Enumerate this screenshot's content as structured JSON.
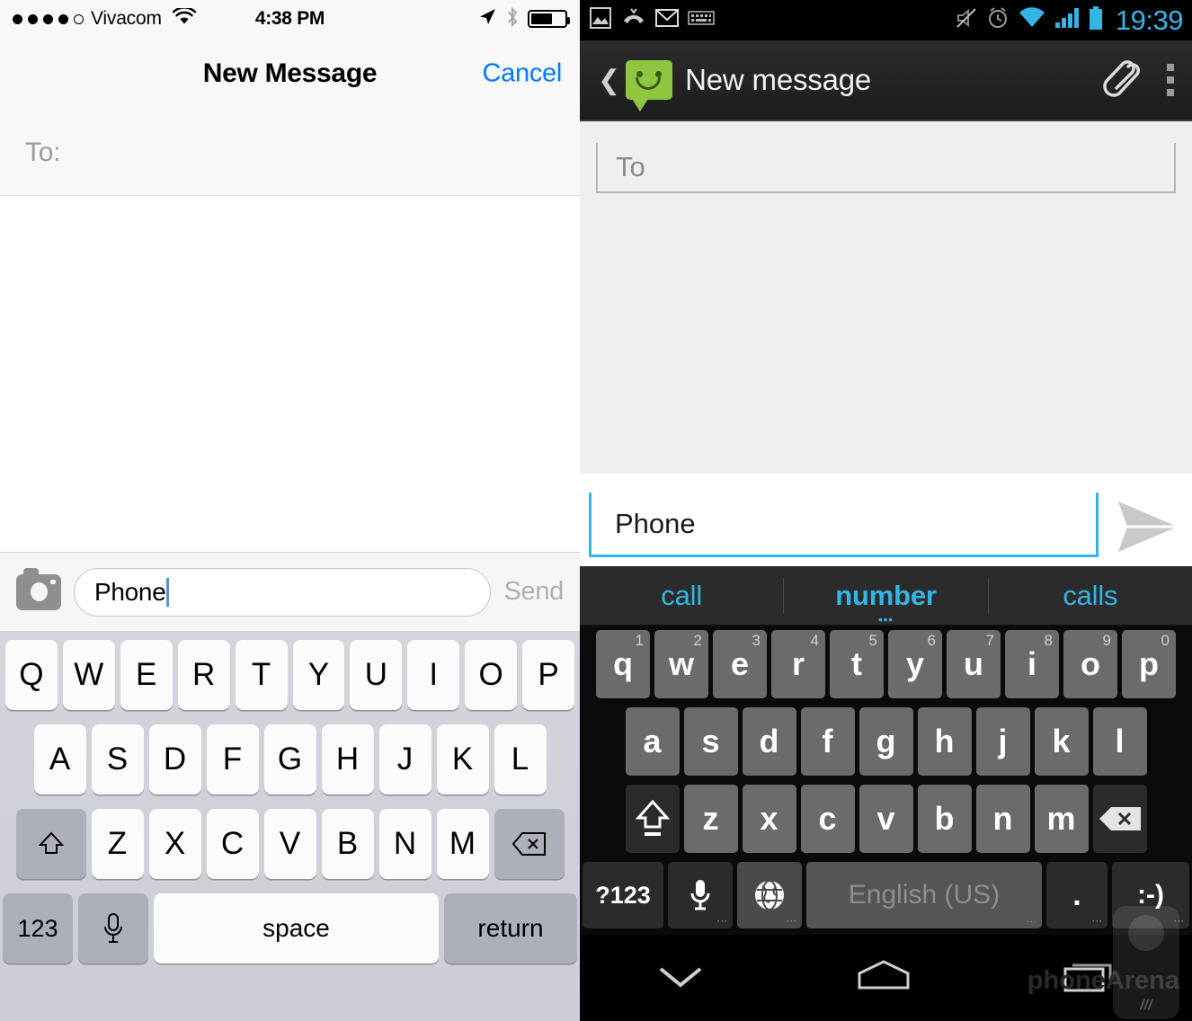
{
  "ios": {
    "statusbar": {
      "signal_dots_filled": 4,
      "signal_dots_total": 5,
      "carrier": "Vivacom",
      "wifi_icon": "wifi-icon",
      "time": "4:38 PM",
      "location_icon": "location-arrow-icon",
      "bluetooth_icon": "bluetooth-icon",
      "battery_icon": "battery-icon",
      "battery_percent": 65
    },
    "navbar": {
      "title": "New Message",
      "cancel_label": "Cancel",
      "cancel_color": "#007aff"
    },
    "compose": {
      "to_label": "To:"
    },
    "inputbar": {
      "camera_icon": "camera-icon",
      "message_value": "Phone",
      "send_label": "Send"
    },
    "keyboard": {
      "row1": [
        "Q",
        "W",
        "E",
        "R",
        "T",
        "Y",
        "U",
        "I",
        "O",
        "P"
      ],
      "row2": [
        "A",
        "S",
        "D",
        "F",
        "G",
        "H",
        "J",
        "K",
        "L"
      ],
      "row3": [
        "Z",
        "X",
        "C",
        "V",
        "B",
        "N",
        "M"
      ],
      "shift_icon": "shift-arrow-icon",
      "delete_icon": "backspace-icon",
      "numbers_label": "123",
      "mic_icon": "microphone-icon",
      "space_label": "space",
      "return_label": "return"
    }
  },
  "android": {
    "statusbar": {
      "left_icons": [
        "image-icon",
        "missed-call-icon",
        "gmail-icon",
        "keyboard-icon"
      ],
      "right_icons": [
        "mute-icon",
        "alarm-icon",
        "wifi-icon",
        "signal-icon",
        "battery-icon"
      ],
      "time": "19:39",
      "accent_color": "#33b5e5"
    },
    "actionbar": {
      "back_icon": "back-chevron-icon",
      "app_icon": "messaging-smiley-icon",
      "app_icon_color": "#8ec63f",
      "title": "New message",
      "attach_icon": "paperclip-icon",
      "overflow_icon": "overflow-menu-icon"
    },
    "compose": {
      "to_placeholder": "To",
      "message_value": "Phone",
      "send_icon": "send-arrow-icon",
      "field_underline_color": "#33b5e5"
    },
    "keyboard": {
      "suggestions": [
        "call",
        "number",
        "calls"
      ],
      "selected_suggestion": "number",
      "row1": [
        "q",
        "w",
        "e",
        "r",
        "t",
        "y",
        "u",
        "i",
        "o",
        "p"
      ],
      "row1_numbers": [
        "1",
        "2",
        "3",
        "4",
        "5",
        "6",
        "7",
        "8",
        "9",
        "0"
      ],
      "row2": [
        "a",
        "s",
        "d",
        "f",
        "g",
        "h",
        "j",
        "k",
        "l"
      ],
      "row3": [
        "z",
        "x",
        "c",
        "v",
        "b",
        "n",
        "m"
      ],
      "shift_icon": "shift-arrow-icon",
      "delete_icon": "backspace-icon",
      "symbols_label": "?123",
      "mic_icon": "microphone-icon",
      "globe_icon": "language-globe-icon",
      "space_label": "English (US)",
      "period_label": ".",
      "emoji_label": ":-)"
    },
    "navbar": {
      "back_icon": "hide-keyboard-chevron-icon",
      "home_icon": "home-icon",
      "recents_icon": "recents-icon"
    },
    "watermark": {
      "text_light": "phone",
      "text_bold": "Arena"
    }
  }
}
